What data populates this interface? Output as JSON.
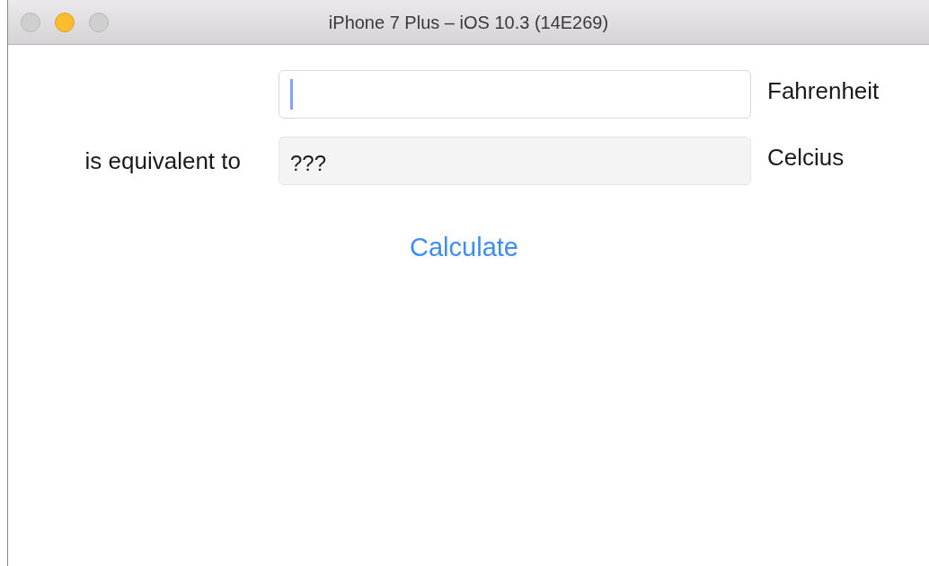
{
  "window": {
    "title": "iPhone 7 Plus – iOS 10.3 (14E269)"
  },
  "rows": [
    {
      "field": {
        "focused": true,
        "disabled": false
      },
      "unit": "Fahrenheit"
    },
    {
      "label": "is equivalent to",
      "field": {
        "value": "???",
        "focused": false,
        "disabled": true
      },
      "unit": "Celcius"
    }
  ],
  "button": "Calculate"
}
